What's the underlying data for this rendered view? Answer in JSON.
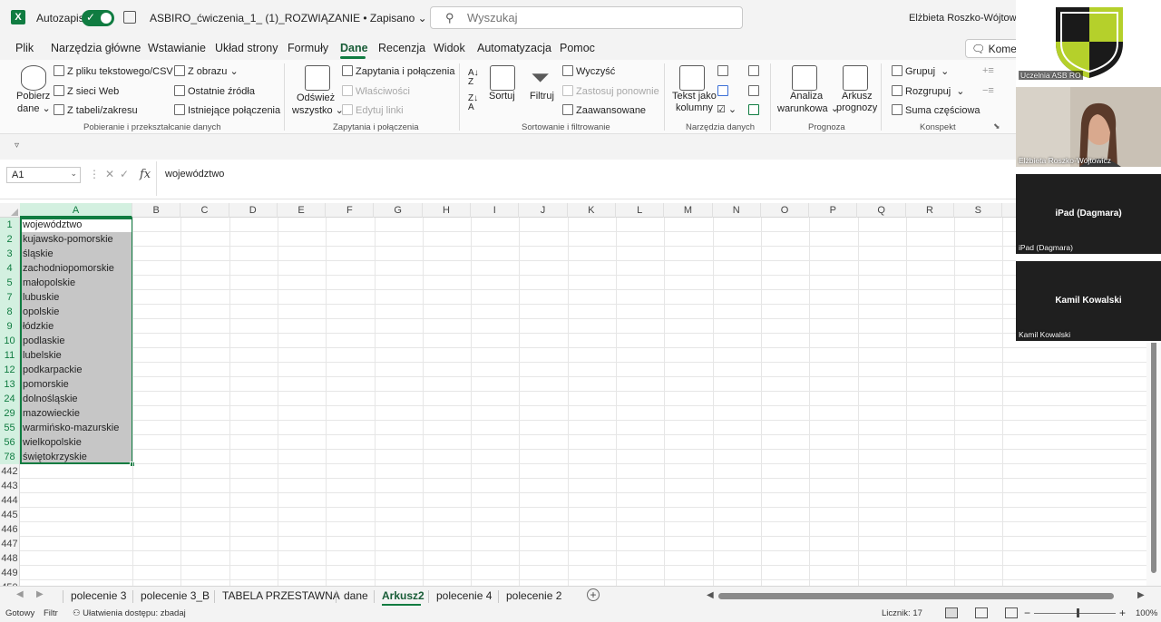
{
  "titlebar": {
    "autosave_label": "Autozapis",
    "document_title": "ASBIRO_ćwiczenia_1_ (1)_ROZWIĄZANIE • Zapisano",
    "search_placeholder": "Wyszukaj",
    "user_name": "Elżbieta Roszko-Wójtowicz"
  },
  "menu": {
    "tabs": [
      "Plik",
      "Narzędzia główne",
      "Wstawianie",
      "Układ strony",
      "Formuły",
      "Dane",
      "Recenzja",
      "Widok",
      "Automatyzacja",
      "Pomoc"
    ],
    "active": "Dane",
    "comments_label": "Komentarze"
  },
  "ribbon": {
    "get_data": {
      "pobierz_line1": "Pobierz",
      "pobierz_line2": "dane",
      "from_text_csv": "Z pliku tekstowego/CSV",
      "from_web": "Z sieci Web",
      "from_table": "Z tabeli/zakresu",
      "from_picture": "Z obrazu",
      "recent_sources": "Ostatnie źródła",
      "existing_connections": "Istniejące połączenia",
      "group_label": "Pobieranie i przekształcanie danych"
    },
    "queries": {
      "refresh_line1": "Odśwież",
      "refresh_line2": "wszystko",
      "queries_connections": "Zapytania i połączenia",
      "properties": "Właściwości",
      "edit_links": "Edytuj linki",
      "group_label": "Zapytania i połączenia"
    },
    "sort_filter": {
      "sort": "Sortuj",
      "filter": "Filtruj",
      "clear": "Wyczyść",
      "reapply": "Zastosuj ponownie",
      "advanced": "Zaawansowane",
      "group_label": "Sortowanie i filtrowanie"
    },
    "data_tools": {
      "text_to_columns_line1": "Tekst jako",
      "text_to_columns_line2": "kolumny",
      "group_label": "Narzędzia danych"
    },
    "forecast": {
      "whatif_line1": "Analiza",
      "whatif_line2": "warunkowa",
      "sheet_line1": "Arkusz",
      "sheet_line2": "prognozy",
      "group_label": "Prognoza"
    },
    "outline": {
      "group": "Grupuj",
      "ungroup": "Rozgrupuj",
      "subtotal": "Suma częściowa",
      "group_label": "Konspekt"
    }
  },
  "formula_bar": {
    "name_box": "A1",
    "fx": "fx",
    "formula": "województwo"
  },
  "grid": {
    "columns": [
      "A",
      "B",
      "C",
      "D",
      "E",
      "F",
      "G",
      "H",
      "I",
      "J",
      "K",
      "L",
      "M",
      "N",
      "O",
      "P",
      "Q",
      "R",
      "S"
    ],
    "selected_column": "A",
    "rows": [
      {
        "num": "1",
        "a": "województwo",
        "sel": true
      },
      {
        "num": "2",
        "a": "kujawsko-pomorskie",
        "sel": true
      },
      {
        "num": "3",
        "a": "śląskie",
        "sel": true
      },
      {
        "num": "4",
        "a": "zachodniopomorskie",
        "sel": true
      },
      {
        "num": "5",
        "a": "małopolskie",
        "sel": true
      },
      {
        "num": "7",
        "a": "lubuskie",
        "sel": true
      },
      {
        "num": "8",
        "a": "opolskie",
        "sel": true
      },
      {
        "num": "9",
        "a": "łódzkie",
        "sel": true
      },
      {
        "num": "10",
        "a": "podlaskie",
        "sel": true
      },
      {
        "num": "11",
        "a": "lubelskie",
        "sel": true
      },
      {
        "num": "12",
        "a": "podkarpackie",
        "sel": true
      },
      {
        "num": "13",
        "a": "pomorskie",
        "sel": true
      },
      {
        "num": "24",
        "a": "dolnośląskie",
        "sel": true
      },
      {
        "num": "29",
        "a": "mazowieckie",
        "sel": true
      },
      {
        "num": "55",
        "a": "warmińsko-mazurskie",
        "sel": true
      },
      {
        "num": "56",
        "a": "wielkopolskie",
        "sel": true
      },
      {
        "num": "78",
        "a": "świętokrzyskie",
        "sel": true
      },
      {
        "num": "442",
        "a": "",
        "sel": false
      },
      {
        "num": "443",
        "a": "",
        "sel": false
      },
      {
        "num": "444",
        "a": "",
        "sel": false
      },
      {
        "num": "445",
        "a": "",
        "sel": false
      },
      {
        "num": "446",
        "a": "",
        "sel": false
      },
      {
        "num": "447",
        "a": "",
        "sel": false
      },
      {
        "num": "448",
        "a": "",
        "sel": false
      },
      {
        "num": "449",
        "a": "",
        "sel": false
      },
      {
        "num": "450",
        "a": "",
        "sel": false
      }
    ]
  },
  "sheets": {
    "tabs": [
      "polecenie 3",
      "polecenie 3_B",
      "TABELA PRZESTAWNA",
      "dane",
      "Arkusz2",
      "polecenie 4",
      "polecenie 2"
    ],
    "active": "Arkusz2"
  },
  "status": {
    "ready": "Gotowy",
    "filter": "Filtr",
    "accessibility": "Ułatwienia dostępu: zbadaj",
    "count": "Licznik: 17",
    "zoom": "100%"
  },
  "video": {
    "tile1_name": "Uczelnia ASB RO",
    "tile2_name": "Elżbieta Roszko-Wójtowicz",
    "tile3_center": "iPad (Dagmara)",
    "tile3_name": "iPad (Dagmara)",
    "tile4_center": "Kamil Kowalski",
    "tile4_name": "Kamil Kowalski"
  },
  "colors": {
    "excel_green": "#107c41",
    "selection_fill": "#c6c6c6"
  }
}
